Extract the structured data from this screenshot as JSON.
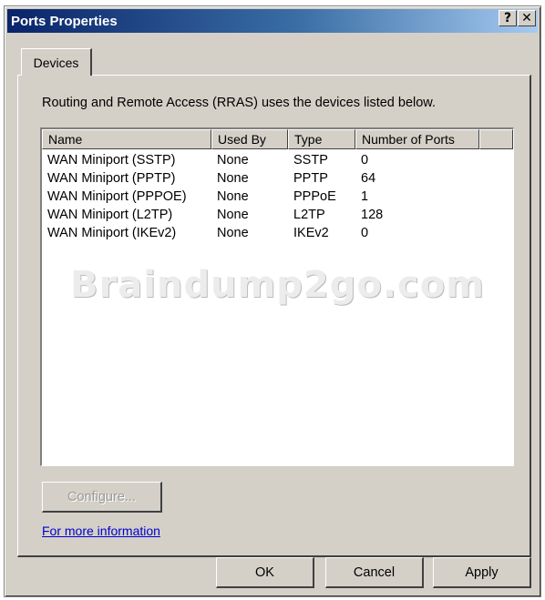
{
  "window": {
    "title": "Ports Properties",
    "help_label": "?",
    "close_label": "✕"
  },
  "tabs": [
    {
      "label": "Devices",
      "active": true
    }
  ],
  "devices": {
    "description": "Routing and Remote Access (RRAS) uses the devices listed below.",
    "columns": [
      "Name",
      "Used By",
      "Type",
      "Number of Ports"
    ],
    "rows": [
      [
        "WAN Miniport (SSTP)",
        "None",
        "SSTP",
        "0"
      ],
      [
        "WAN Miniport (PPTP)",
        "None",
        "PPTP",
        "64"
      ],
      [
        "WAN Miniport (PPPOE)",
        "None",
        "PPPoE",
        "1"
      ],
      [
        "WAN Miniport (L2TP)",
        "None",
        "L2TP",
        "128"
      ],
      [
        "WAN Miniport (IKEv2)",
        "None",
        "IKEv2",
        "0"
      ]
    ],
    "watermark": "Braindump2go.com",
    "configure_label": "Configure...",
    "more_info_link": "For more information"
  },
  "footer": {
    "ok_label": "OK",
    "cancel_label": "Cancel",
    "apply_label": "Apply"
  },
  "colors": {
    "title_start": "#0a246a",
    "title_end": "#a6caf0",
    "face": "#d4d0c8",
    "link": "#0000cc"
  }
}
